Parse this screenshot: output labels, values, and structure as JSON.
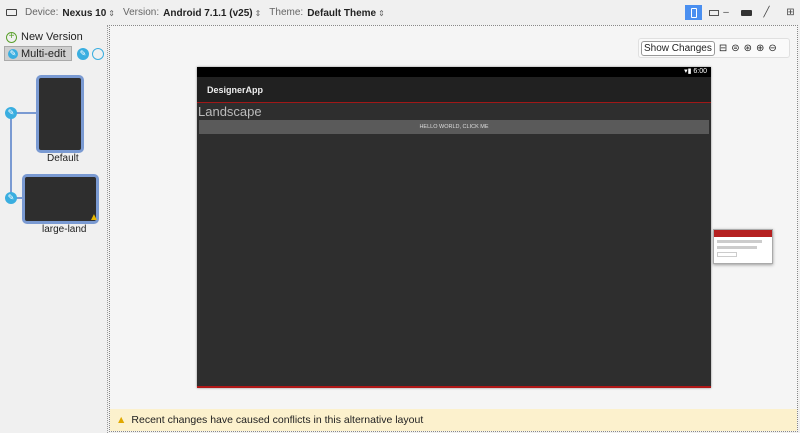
{
  "toolbar": {
    "device_label": "Device:",
    "device": "Nexus 10",
    "version_label": "Version:",
    "version": "Android 7.1.1 (v25)",
    "theme_label": "Theme:",
    "theme": "Default Theme"
  },
  "left": {
    "new_version": "New Version",
    "multi_edit": "Multi-edit",
    "versions": [
      {
        "name": "Default"
      },
      {
        "name": "large-land"
      }
    ]
  },
  "canvas": {
    "show_changes": "Show Changes"
  },
  "device": {
    "time": "6:00",
    "app_title": "DesignerApp",
    "landscape_text": "Landscape",
    "button": "HELLO WORLD, CLICK ME"
  },
  "warning": {
    "text": "Recent changes have caused conflicts in this alternative layout"
  }
}
